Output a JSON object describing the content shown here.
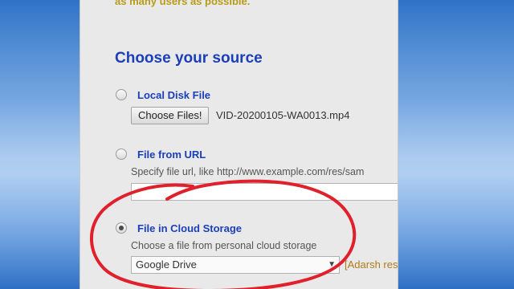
{
  "intro_text": "as many users as possible.",
  "section": {
    "title": "Choose your source"
  },
  "local_disk": {
    "label": "Local Disk File",
    "button_label": "Choose Files!",
    "selected_file": "VID-20200105-WA0013.mp4",
    "checked": false
  },
  "url_source": {
    "label": "File from URL",
    "hint": "Specify file url, like http://www.example.com/res/sam",
    "value": "",
    "checked": false
  },
  "cloud": {
    "label": "File in Cloud Storage",
    "hint": "Choose a file from personal cloud storage",
    "selected": "Google Drive",
    "note": "[Adarsh res",
    "checked": true
  },
  "colors": {
    "label_blue": "#1a3fb8",
    "annotation_red": "#e0202b",
    "panel_bg": "#e9e9e9"
  }
}
